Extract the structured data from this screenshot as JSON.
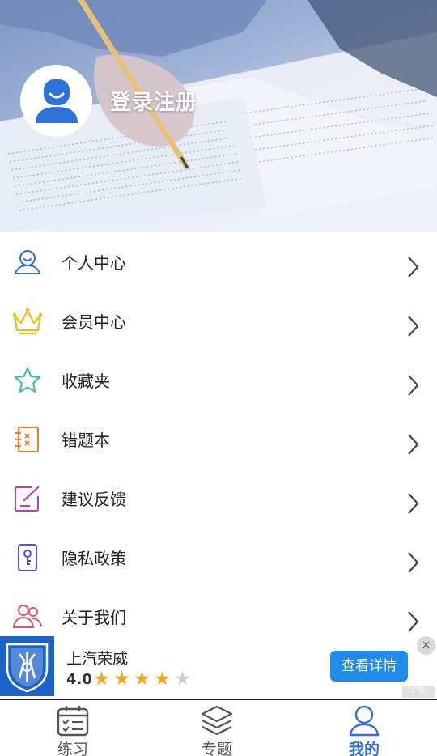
{
  "header": {
    "login_label": "登录注册"
  },
  "menu": {
    "items": [
      {
        "label": "个人中心",
        "icon": "person-smile-icon"
      },
      {
        "label": "会员中心",
        "icon": "crown-icon"
      },
      {
        "label": "收藏夹",
        "icon": "star-icon"
      },
      {
        "label": "错题本",
        "icon": "wrong-notebook-icon"
      },
      {
        "label": "建议反馈",
        "icon": "feedback-edit-icon"
      },
      {
        "label": "隐私政策",
        "icon": "privacy-key-icon"
      },
      {
        "label": "关于我们",
        "icon": "group-icon"
      }
    ]
  },
  "ad": {
    "title": "上汽荣威",
    "rating": "4.0",
    "rating_value": 4,
    "rating_max": 5,
    "button_label": "查看详情",
    "close_symbol": "×",
    "ad_mark": "广告"
  },
  "tabbar": {
    "tabs": [
      {
        "label": "练习",
        "icon": "calendar-check-icon",
        "active": false
      },
      {
        "label": "专题",
        "icon": "layers-icon",
        "active": false
      },
      {
        "label": "我的",
        "icon": "person-icon",
        "active": true
      }
    ]
  },
  "colors": {
    "accent": "#2f6fe0",
    "ad_button": "#1e8ce8",
    "ad_logo_bg": "#1b62c9",
    "star_filled": "#f5a623",
    "star_empty": "#cccccc"
  }
}
